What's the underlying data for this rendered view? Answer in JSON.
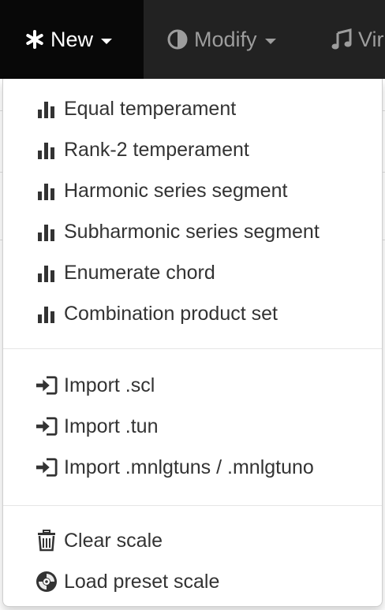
{
  "navbar": {
    "items": [
      {
        "label": "New",
        "icon": "asterisk-icon",
        "active": true
      },
      {
        "label": "Modify",
        "icon": "adjust-icon",
        "active": false
      },
      {
        "label": "Vir",
        "icon": "music-note-icon",
        "active": false
      }
    ]
  },
  "menu": {
    "group_generate": [
      {
        "label": "Equal temperament",
        "icon": "bar-chart-icon"
      },
      {
        "label": "Rank-2 temperament",
        "icon": "bar-chart-icon"
      },
      {
        "label": "Harmonic series segment",
        "icon": "bar-chart-icon"
      },
      {
        "label": "Subharmonic series segment",
        "icon": "bar-chart-icon"
      },
      {
        "label": "Enumerate chord",
        "icon": "bar-chart-icon"
      },
      {
        "label": "Combination product set",
        "icon": "bar-chart-icon"
      }
    ],
    "group_import": [
      {
        "label": "Import .scl",
        "icon": "log-in-icon"
      },
      {
        "label": "Import .tun",
        "icon": "log-in-icon"
      },
      {
        "label": "Import .mnlgtuns / .mnlgtuno",
        "icon": "log-in-icon"
      }
    ],
    "group_misc": [
      {
        "label": "Clear scale",
        "icon": "trash-icon"
      },
      {
        "label": "Load preset scale",
        "icon": "cd-icon"
      }
    ]
  },
  "colors": {
    "navbar_bg": "#222222",
    "navbar_active_bg": "#080808",
    "menu_text": "#333333"
  }
}
